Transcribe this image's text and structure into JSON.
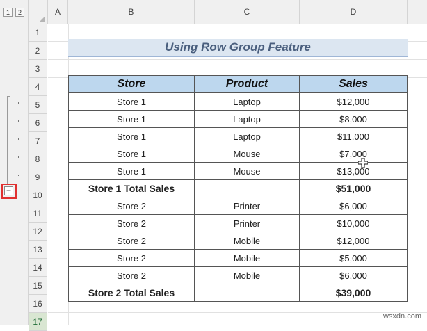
{
  "outline": {
    "levels": [
      "1",
      "2"
    ],
    "collapse_symbol": "−"
  },
  "columns": [
    "A",
    "B",
    "C",
    "D"
  ],
  "rows": [
    "1",
    "2",
    "3",
    "4",
    "5",
    "6",
    "7",
    "8",
    "9",
    "10",
    "11",
    "12",
    "13",
    "14",
    "15",
    "16",
    "17"
  ],
  "title": "Using Row Group Feature",
  "table": {
    "headers": [
      "Store",
      "Product",
      "Sales"
    ],
    "body": [
      [
        "Store 1",
        "Laptop",
        "$12,000"
      ],
      [
        "Store 1",
        "Laptop",
        "$8,000"
      ],
      [
        "Store 1",
        "Laptop",
        "$11,000"
      ],
      [
        "Store 1",
        "Mouse",
        "$7,000"
      ],
      [
        "Store 1",
        "Mouse",
        "$13,000"
      ],
      [
        "Store 1 Total Sales",
        "",
        "$51,000"
      ],
      [
        "Store 2",
        "Printer",
        "$6,000"
      ],
      [
        "Store 2",
        "Printer",
        "$10,000"
      ],
      [
        "Store 2",
        "Mobile",
        "$12,000"
      ],
      [
        "Store 2",
        "Mobile",
        "$5,000"
      ],
      [
        "Store 2",
        "Mobile",
        "$6,000"
      ],
      [
        "Store 2 Total Sales",
        "",
        "$39,000"
      ]
    ]
  },
  "watermark": "wsxdn.com"
}
